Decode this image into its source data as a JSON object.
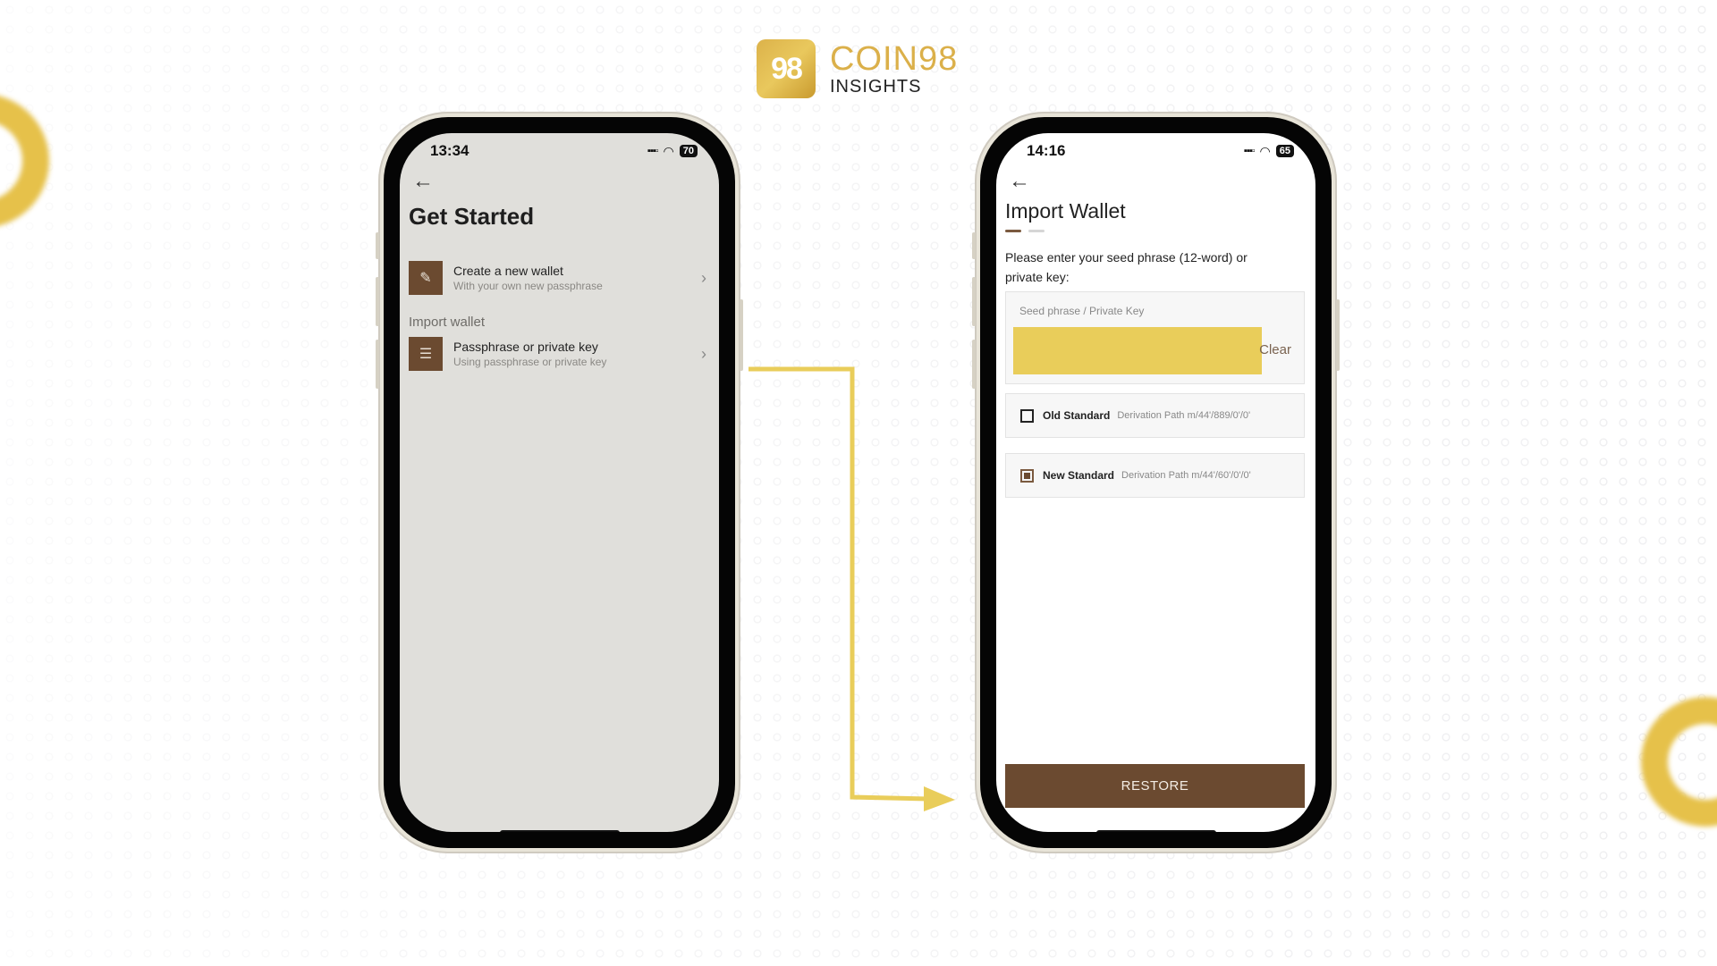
{
  "brand": {
    "logo_mark": "98",
    "name": "COIN98",
    "sub": "INSIGHTS"
  },
  "colors": {
    "accent": "#e9cd5a",
    "brown": "#6b4a30",
    "gold": "#dbb04a"
  },
  "left_phone": {
    "status": {
      "time": "13:34",
      "battery": "70",
      "signal_icon": "signal-icon",
      "wifi_icon": "wifi-icon"
    },
    "back_icon": "arrow-left-icon",
    "title": "Get Started",
    "create": {
      "title": "Create a new wallet",
      "subtitle": "With your own new passphrase",
      "icon": "pencil-icon"
    },
    "import_section": "Import wallet",
    "import": {
      "title": "Passphrase or private key",
      "subtitle": "Using passphrase or private key",
      "icon": "document-icon"
    }
  },
  "right_phone": {
    "status": {
      "time": "14:16",
      "battery": "65"
    },
    "title": "Import Wallet",
    "step": {
      "current": 1,
      "total": 2
    },
    "instruction": "Please enter your seed phrase (12-word) or private key:",
    "input": {
      "label": "Seed phrase / Private Key",
      "value": "",
      "clear_label": "Clear"
    },
    "options": [
      {
        "name": "Old Standard",
        "path": "Derivation Path m/44'/889/0'/0'",
        "checked": false
      },
      {
        "name": "New Standard",
        "path": "Derivation Path m/44'/60'/0'/0'",
        "checked": true
      }
    ],
    "restore_label": "RESTORE"
  }
}
